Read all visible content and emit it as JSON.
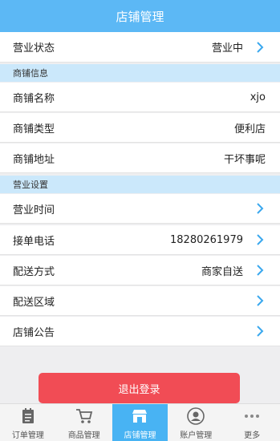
{
  "header": {
    "title": "店铺管理"
  },
  "status_row": {
    "label": "营业状态",
    "value": "营业中"
  },
  "section_info": {
    "title": "商铺信息"
  },
  "info": {
    "name": {
      "label": "商铺名称",
      "value": "xjo"
    },
    "type": {
      "label": "商铺类型",
      "value": "便利店"
    },
    "address": {
      "label": "商铺地址",
      "value": "干坏事呢"
    }
  },
  "section_settings": {
    "title": "营业设置"
  },
  "settings": {
    "hours": {
      "label": "营业时间",
      "value": ""
    },
    "phone": {
      "label": "接单电话",
      "value": "18280261979"
    },
    "delivery": {
      "label": "配送方式",
      "value": "商家自送"
    },
    "area": {
      "label": "配送区域",
      "value": ""
    },
    "notice": {
      "label": "店铺公告",
      "value": ""
    }
  },
  "logout": {
    "label": "退出登录"
  },
  "tabs": [
    {
      "label": "订单管理",
      "icon": "order-icon"
    },
    {
      "label": "商品管理",
      "icon": "cart-icon"
    },
    {
      "label": "店铺管理",
      "icon": "store-icon"
    },
    {
      "label": "账户管理",
      "icon": "account-icon"
    },
    {
      "label": "更多",
      "icon": "more-icon"
    }
  ],
  "colors": {
    "accent": "#5cb8f5",
    "active_tab": "#48b3f3",
    "section_bg": "#cbe8fb",
    "logout": "#f14c55",
    "chevron": "#3aa8ee"
  }
}
